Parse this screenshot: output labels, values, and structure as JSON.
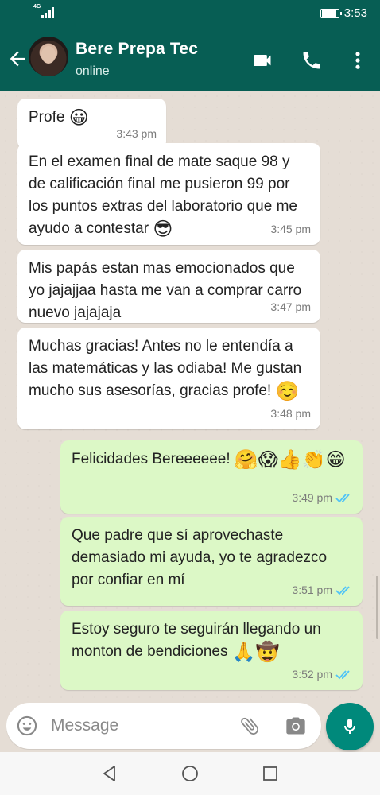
{
  "status_bar": {
    "network": "4G",
    "time": "3:53",
    "battery_level": 0.9
  },
  "header": {
    "contact_name": "Bere Prepa Tec",
    "contact_status": "online",
    "icons": [
      "back-arrow-icon",
      "avatar",
      "video-call-icon",
      "phone-icon",
      "more-vert-icon"
    ]
  },
  "messages": [
    {
      "direction": "incoming",
      "text": "Profe",
      "emoji": "😀",
      "time": "3:43 pm"
    },
    {
      "direction": "incoming",
      "text": "En el examen final de mate saque 98 y de calificación final me pusieron 99 por los puntos extras del laboratorio que me ayudo a contestar",
      "emoji": "😎",
      "time": "3:45 pm"
    },
    {
      "direction": "incoming",
      "text": "Mis papás estan mas emocionados que yo jajajjaa hasta me van a comprar carro nuevo jajajaja",
      "emoji": "",
      "time": "3:47 pm"
    },
    {
      "direction": "incoming",
      "text": "Muchas gracias! Antes no le entendía a las matemáticas y las odiaba! Me gustan mucho sus asesorías, gracias profe!",
      "emoji": "☺️",
      "time": "3:48 pm"
    },
    {
      "direction": "outgoing",
      "text": "Felicidades Bereeeeee!",
      "emoji": "🤗😱👍👏😁",
      "time": "3:49 pm",
      "status": "read"
    },
    {
      "direction": "outgoing",
      "text": "Que padre que sí aprovechaste demasiado mi ayuda, yo te agradezco por confiar en mí",
      "emoji": "",
      "time": "3:51 pm",
      "status": "read"
    },
    {
      "direction": "outgoing",
      "text": "Estoy seguro te seguirán llegando un monton de bendiciones",
      "emoji": "🙏🤠",
      "time": "3:52 pm",
      "status": "read"
    }
  ],
  "input": {
    "placeholder": "Message",
    "value": ""
  },
  "colors": {
    "header": "#075e54",
    "chat_bg": "#e5ddd5",
    "outgoing_bubble": "#dcf8c6",
    "incoming_bubble": "#ffffff",
    "read_ticks": "#4fc3f7",
    "mic_button": "#00897b"
  }
}
